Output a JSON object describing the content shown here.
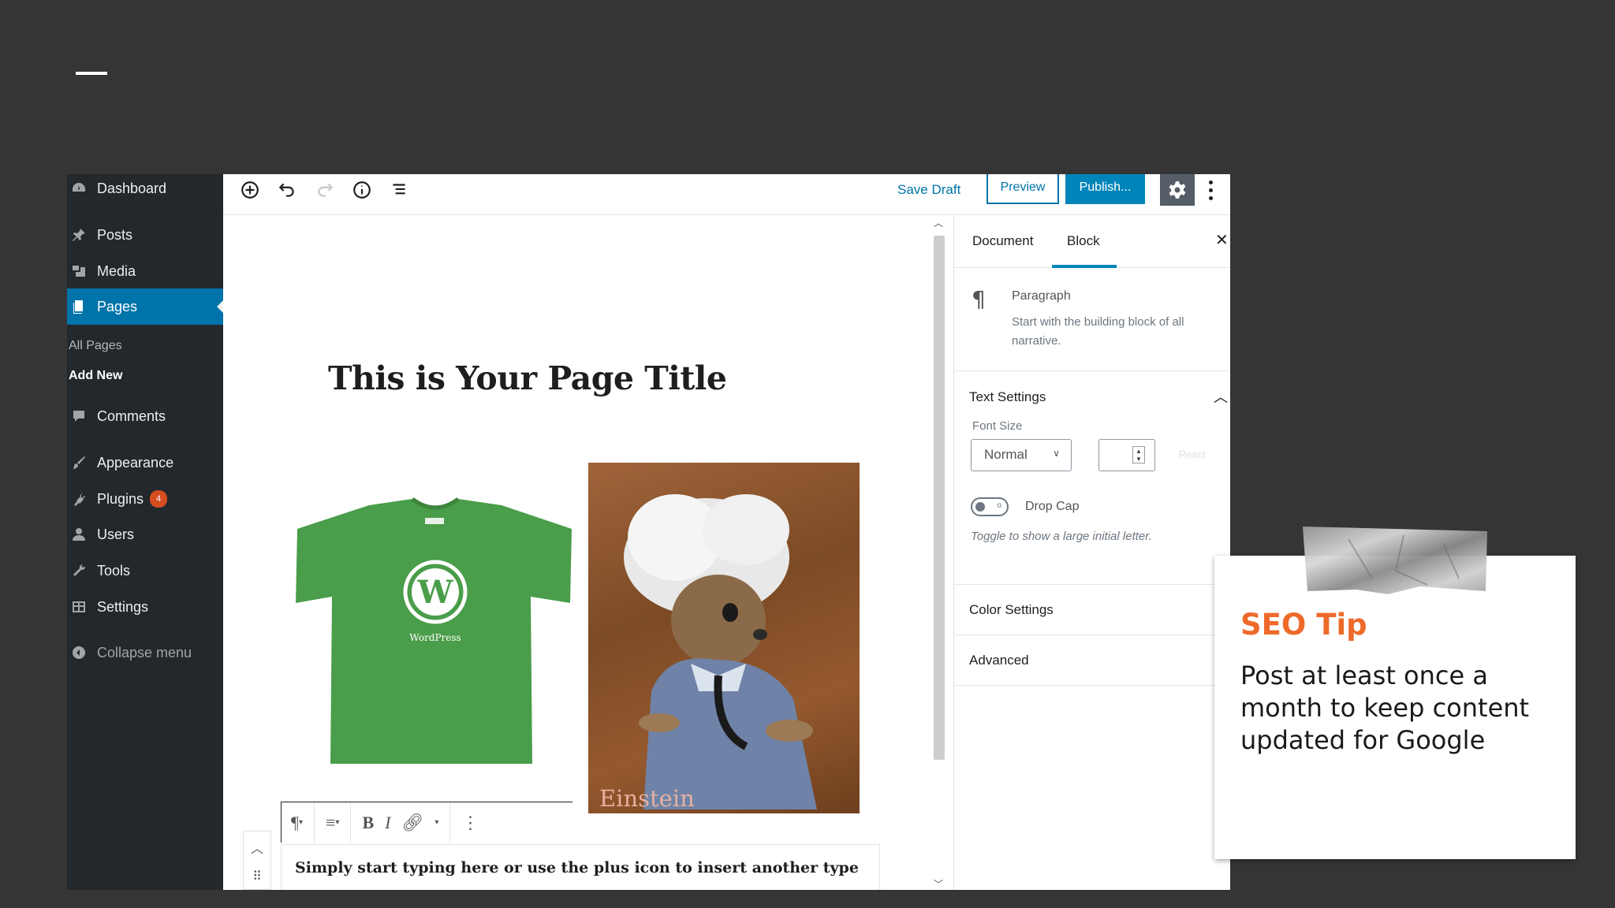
{
  "slide": {
    "accent_color": "#ee6a2a",
    "background_color": "#353535"
  },
  "wp_sidebar": {
    "items": [
      {
        "label": "Dashboard",
        "icon": "dashboard-icon"
      },
      {
        "label": "Posts",
        "icon": "pin-icon"
      },
      {
        "label": "Media",
        "icon": "media-icon"
      },
      {
        "label": "Pages",
        "icon": "pages-icon",
        "active": true
      },
      {
        "label": "Comments",
        "icon": "comment-icon"
      },
      {
        "label": "Appearance",
        "icon": "brush-icon"
      },
      {
        "label": "Plugins",
        "icon": "plugin-icon",
        "badge": "4"
      },
      {
        "label": "Users",
        "icon": "user-icon"
      },
      {
        "label": "Tools",
        "icon": "wrench-icon"
      },
      {
        "label": "Settings",
        "icon": "settings-icon"
      }
    ],
    "submenu": [
      "All Pages",
      "Add New"
    ],
    "collapse_label": "Collapse menu",
    "active_color": "#0073aa"
  },
  "topbar": {
    "save_draft": "Save Draft",
    "preview": "Preview",
    "publish": "Publish..."
  },
  "editor": {
    "page_title": "This is Your Page Title",
    "tshirt_logo_text": "WordPress",
    "image_caption": "Einstein",
    "paragraph_text": "Simply start typing here or use the plus icon to insert another type"
  },
  "panel": {
    "tabs": [
      "Document",
      "Block"
    ],
    "active_tab": "Block",
    "block_name": "Paragraph",
    "block_description": "Start with the building block of all narrative.",
    "text_settings": "Text Settings",
    "font_size_label": "Font Size",
    "font_size_value": "Normal",
    "reset_label": "Reset",
    "drop_cap_label": "Drop Cap",
    "drop_cap_help": "Toggle to show a large initial letter.",
    "color_settings": "Color Settings",
    "advanced": "Advanced"
  },
  "tip": {
    "title": "SEO Tip",
    "body": "Post at least once a month to keep content updated for Google"
  }
}
